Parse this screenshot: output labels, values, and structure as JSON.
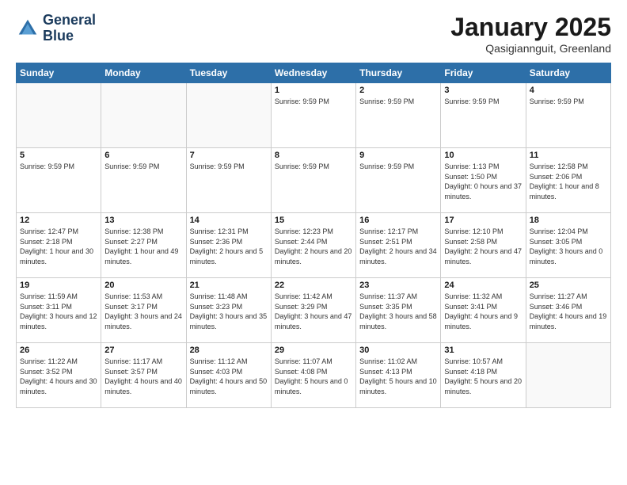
{
  "logo": {
    "line1": "General",
    "line2": "Blue"
  },
  "header": {
    "month": "January 2025",
    "location": "Qasigiannguit, Greenland"
  },
  "weekdays": [
    "Sunday",
    "Monday",
    "Tuesday",
    "Wednesday",
    "Thursday",
    "Friday",
    "Saturday"
  ],
  "weeks": [
    [
      {
        "day": "",
        "info": ""
      },
      {
        "day": "",
        "info": ""
      },
      {
        "day": "",
        "info": ""
      },
      {
        "day": "1",
        "info": "Sunrise: 9:59 PM"
      },
      {
        "day": "2",
        "info": "Sunrise: 9:59 PM"
      },
      {
        "day": "3",
        "info": "Sunrise: 9:59 PM"
      },
      {
        "day": "4",
        "info": "Sunrise: 9:59 PM"
      }
    ],
    [
      {
        "day": "5",
        "info": "Sunrise: 9:59 PM"
      },
      {
        "day": "6",
        "info": "Sunrise: 9:59 PM"
      },
      {
        "day": "7",
        "info": "Sunrise: 9:59 PM"
      },
      {
        "day": "8",
        "info": "Sunrise: 9:59 PM"
      },
      {
        "day": "9",
        "info": "Sunrise: 9:59 PM"
      },
      {
        "day": "10",
        "info": "Sunrise: 1:13 PM\nSunset: 1:50 PM\nDaylight: 0 hours and 37 minutes."
      },
      {
        "day": "11",
        "info": "Sunrise: 12:58 PM\nSunset: 2:06 PM\nDaylight: 1 hour and 8 minutes."
      }
    ],
    [
      {
        "day": "12",
        "info": "Sunrise: 12:47 PM\nSunset: 2:18 PM\nDaylight: 1 hour and 30 minutes."
      },
      {
        "day": "13",
        "info": "Sunrise: 12:38 PM\nSunset: 2:27 PM\nDaylight: 1 hour and 49 minutes."
      },
      {
        "day": "14",
        "info": "Sunrise: 12:31 PM\nSunset: 2:36 PM\nDaylight: 2 hours and 5 minutes."
      },
      {
        "day": "15",
        "info": "Sunrise: 12:23 PM\nSunset: 2:44 PM\nDaylight: 2 hours and 20 minutes."
      },
      {
        "day": "16",
        "info": "Sunrise: 12:17 PM\nSunset: 2:51 PM\nDaylight: 2 hours and 34 minutes."
      },
      {
        "day": "17",
        "info": "Sunrise: 12:10 PM\nSunset: 2:58 PM\nDaylight: 2 hours and 47 minutes."
      },
      {
        "day": "18",
        "info": "Sunrise: 12:04 PM\nSunset: 3:05 PM\nDaylight: 3 hours and 0 minutes."
      }
    ],
    [
      {
        "day": "19",
        "info": "Sunrise: 11:59 AM\nSunset: 3:11 PM\nDaylight: 3 hours and 12 minutes."
      },
      {
        "day": "20",
        "info": "Sunrise: 11:53 AM\nSunset: 3:17 PM\nDaylight: 3 hours and 24 minutes."
      },
      {
        "day": "21",
        "info": "Sunrise: 11:48 AM\nSunset: 3:23 PM\nDaylight: 3 hours and 35 minutes."
      },
      {
        "day": "22",
        "info": "Sunrise: 11:42 AM\nSunset: 3:29 PM\nDaylight: 3 hours and 47 minutes."
      },
      {
        "day": "23",
        "info": "Sunrise: 11:37 AM\nSunset: 3:35 PM\nDaylight: 3 hours and 58 minutes."
      },
      {
        "day": "24",
        "info": "Sunrise: 11:32 AM\nSunset: 3:41 PM\nDaylight: 4 hours and 9 minutes."
      },
      {
        "day": "25",
        "info": "Sunrise: 11:27 AM\nSunset: 3:46 PM\nDaylight: 4 hours and 19 minutes."
      }
    ],
    [
      {
        "day": "26",
        "info": "Sunrise: 11:22 AM\nSunset: 3:52 PM\nDaylight: 4 hours and 30 minutes."
      },
      {
        "day": "27",
        "info": "Sunrise: 11:17 AM\nSunset: 3:57 PM\nDaylight: 4 hours and 40 minutes."
      },
      {
        "day": "28",
        "info": "Sunrise: 11:12 AM\nSunset: 4:03 PM\nDaylight: 4 hours and 50 minutes."
      },
      {
        "day": "29",
        "info": "Sunrise: 11:07 AM\nSunset: 4:08 PM\nDaylight: 5 hours and 0 minutes."
      },
      {
        "day": "30",
        "info": "Sunrise: 11:02 AM\nSunset: 4:13 PM\nDaylight: 5 hours and 10 minutes."
      },
      {
        "day": "31",
        "info": "Sunrise: 10:57 AM\nSunset: 4:18 PM\nDaylight: 5 hours and 20 minutes."
      },
      {
        "day": "",
        "info": ""
      }
    ]
  ]
}
